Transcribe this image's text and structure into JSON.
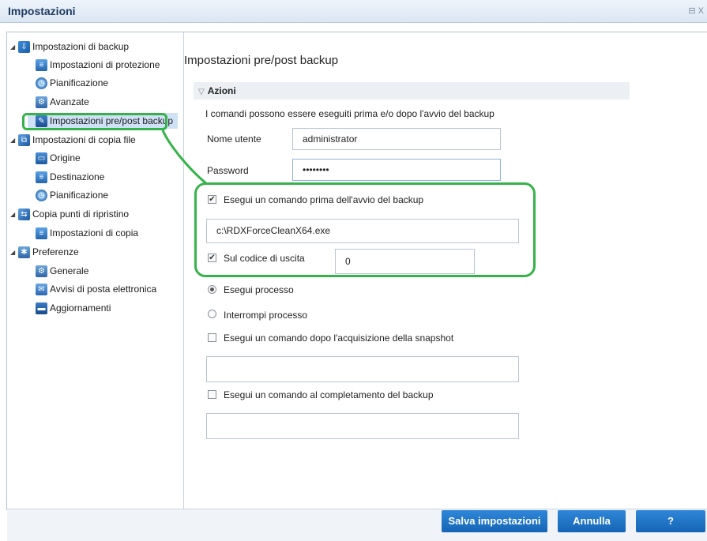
{
  "window": {
    "title": "Impostazioni",
    "controls": "⊟ X"
  },
  "sidebar": {
    "items": [
      {
        "label": "Impostazioni di backup",
        "icon": "backup-icon",
        "level": 0
      },
      {
        "label": "Impostazioni di protezione",
        "icon": "document-icon",
        "level": 1
      },
      {
        "label": "Pianificazione",
        "icon": "clock-icon",
        "level": 1
      },
      {
        "label": "Avanzate",
        "icon": "gear-icon",
        "level": 1
      },
      {
        "label": "Impostazioni pre/post backup",
        "icon": "wrench-icon",
        "level": 1,
        "selected": true
      },
      {
        "label": "Impostazioni di copia file",
        "icon": "file-copy-icon",
        "level": 0
      },
      {
        "label": "Origine",
        "icon": "folder-icon",
        "level": 1
      },
      {
        "label": "Destinazione",
        "icon": "document-icon",
        "level": 1
      },
      {
        "label": "Pianificazione",
        "icon": "clock-icon",
        "level": 1
      },
      {
        "label": "Copia punti di ripristino",
        "icon": "recovery-point-icon",
        "level": 0
      },
      {
        "label": "Impostazioni di copia",
        "icon": "document-icon",
        "level": 1
      },
      {
        "label": "Preferenze",
        "icon": "preferences-icon",
        "level": 0
      },
      {
        "label": "Generale",
        "icon": "general-icon",
        "level": 1
      },
      {
        "label": "Avvisi di posta elettronica",
        "icon": "mail-icon",
        "level": 1
      },
      {
        "label": "Aggiornamenti",
        "icon": "monitor-icon",
        "level": 1
      }
    ]
  },
  "main": {
    "section_title": "Impostazioni pre/post backup",
    "group_title": "Azioni",
    "description": "I comandi possono essere eseguiti prima e/o dopo l'avvio del backup",
    "username_label": "Nome utente",
    "username_value": "administrator",
    "password_label": "Password",
    "password_value": "••••••••",
    "pre_cmd_label": "Esegui un comando prima dell'avvio del backup",
    "pre_cmd_checked": true,
    "pre_cmd_value": "c:\\RDXForceCleanX64.exe",
    "exit_code_label": "Sul codice di uscita",
    "exit_code_checked": true,
    "exit_code_value": "0",
    "run_process_label": "Esegui processo",
    "stop_process_label": "Interrompi processo",
    "snapshot_cmd_label": "Esegui un comando dopo l'acquisizione della snapshot",
    "snapshot_cmd_value": "",
    "complete_cmd_label": "Esegui un comando al completamento del backup",
    "complete_cmd_value": ""
  },
  "footer": {
    "save_label": "Salva impostazioni",
    "cancel_label": "Annulla",
    "help_label": "?"
  },
  "colors": {
    "accent": "#1a6fc4",
    "highlight": "#35b34a",
    "selected_bg": "#cfe1f5"
  }
}
